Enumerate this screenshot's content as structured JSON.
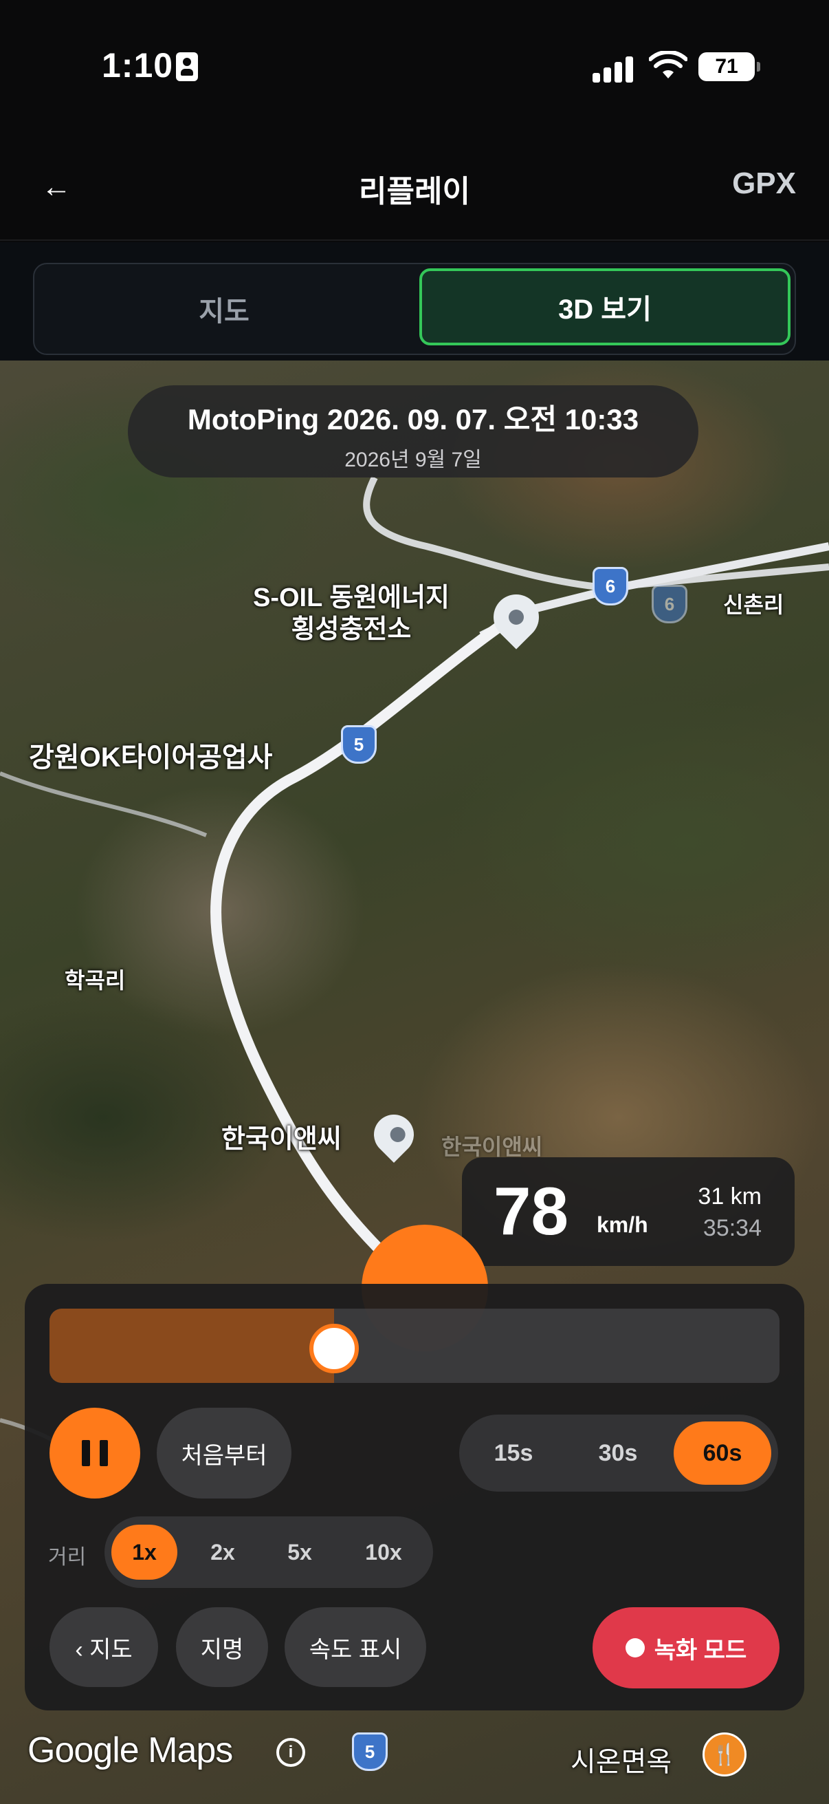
{
  "status_bar": {
    "time": "1:10",
    "battery": "71"
  },
  "header": {
    "title": "리플레이",
    "back_icon": "←",
    "gpx_label": "GPX"
  },
  "view_toggle": {
    "map_label": "지도",
    "three_d_label": "3D 보기",
    "selected": "3D 보기"
  },
  "ride": {
    "title": "MotoPing 2026. 09. 07. 오전 10:33",
    "date": "2026년 9월 7일"
  },
  "map_labels": {
    "station_line1": "S-OIL 동원에너지",
    "station_line2": "횡성충전소",
    "tire_shop": "강원OK타이어공업사",
    "village_hakgok": "학곡리",
    "village_sinchon": "신촌리",
    "company": "한국이앤씨",
    "company_faded": "한국이앤씨",
    "restaurant": "시온면옥",
    "route_shields": [
      "6",
      "6",
      "5",
      "5"
    ],
    "attribution": "Google Maps"
  },
  "telemetry": {
    "speed": "78",
    "speed_unit": "km/h",
    "distance": "31 km",
    "elapsed": "35:34"
  },
  "playback": {
    "progress": 0.39,
    "restart_label": "처음부터",
    "windows": [
      "15s",
      "30s",
      "60s"
    ],
    "selected_window": "60s",
    "distance_label": "거리",
    "multipliers": [
      "1x",
      "2x",
      "5x",
      "10x"
    ],
    "selected_multiplier": "1x",
    "back_to_map_label": "‹ 지도",
    "place_names_label": "지명",
    "show_speed_label": "속도 표시",
    "record_label": "녹화 모드"
  },
  "colors": {
    "accent": "#ff7a1a",
    "active_toggle": "#34c759",
    "record": "#e0394a"
  }
}
